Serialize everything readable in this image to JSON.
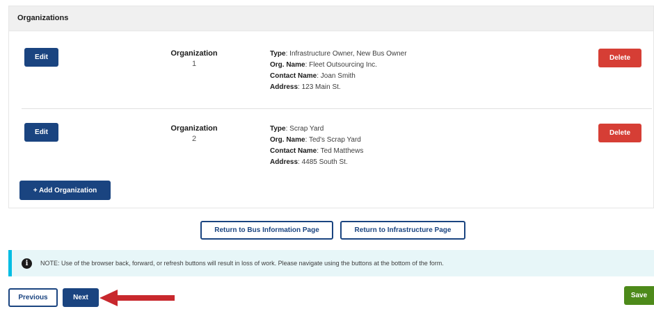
{
  "panel": {
    "title": "Organizations"
  },
  "organizations": [
    {
      "edit_label": "Edit",
      "label": "Organization",
      "number": "1",
      "type_key": "Type",
      "type": ": Infrastructure Owner, New Bus Owner",
      "org_name_key": "Org. Name",
      "org_name": ": Fleet Outsourcing Inc.",
      "contact_key": "Contact Name",
      "contact": ": Joan Smith",
      "address_key": "Address",
      "address": ": 123 Main St.",
      "delete_label": "Delete"
    },
    {
      "edit_label": "Edit",
      "label": "Organization",
      "number": "2",
      "type_key": "Type",
      "type": ": Scrap Yard",
      "org_name_key": "Org. Name",
      "org_name": ": Ted's Scrap Yard",
      "contact_key": "Contact Name",
      "contact": ": Ted Matthews",
      "address_key": "Address",
      "address": ": 4485 South St.",
      "delete_label": "Delete"
    }
  ],
  "add_organization_label": "+ Add Organization",
  "return_bus_label": "Return to Bus Information Page",
  "return_infra_label": "Return to Infrastructure Page",
  "note": {
    "icon": "info-icon",
    "text": "NOTE: Use of the browser back, forward, or refresh buttons will result in loss of work. Please navigate using the buttons at the bottom of the form."
  },
  "footer": {
    "previous_label": "Previous",
    "next_label": "Next",
    "save_label": "Save"
  },
  "colors": {
    "primary": "#1a4480",
    "danger": "#d63e35",
    "success": "#4d8a1a",
    "note_accent": "#00bde3",
    "annotation_arrow": "#c8282d"
  }
}
